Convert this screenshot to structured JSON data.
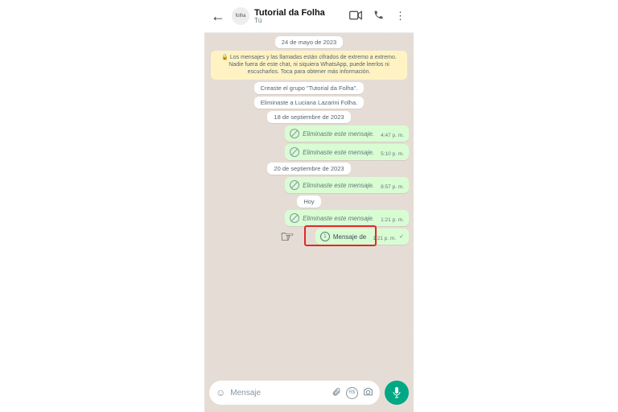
{
  "header": {
    "title": "Tutorial da Folha",
    "subtitle": "Tú",
    "avatar_text": "folha"
  },
  "dates": {
    "d1": "24 de mayo de 2023",
    "d2": "18 de septiembre de 2023",
    "d3": "20 de septiembre de 2023",
    "today": "Hoy"
  },
  "encryption_notice": "🔒 Los mensajes y las llamadas están cifrados de extremo a extremo. Nadie fuera de este chat, ni siquiera WhatsApp, puede leerlos ni escucharlos. Toca para obtener más información.",
  "system": {
    "created": "Creaste el grupo \"Tutorial da Folha\".",
    "removed": "Eliminaste a Luciana Lazarini Folha."
  },
  "deleted_text": "Eliminaste este mensaje.",
  "times": {
    "t1": "4:47 p. m.",
    "t2": "5:10 p. m.",
    "t3": "8:57 p. m.",
    "t4": "1:21 p. m.",
    "t5": "1:21 p. m."
  },
  "voice_label": "Mensaje de",
  "one_label": "1",
  "input": {
    "placeholder": "Mensaje"
  }
}
